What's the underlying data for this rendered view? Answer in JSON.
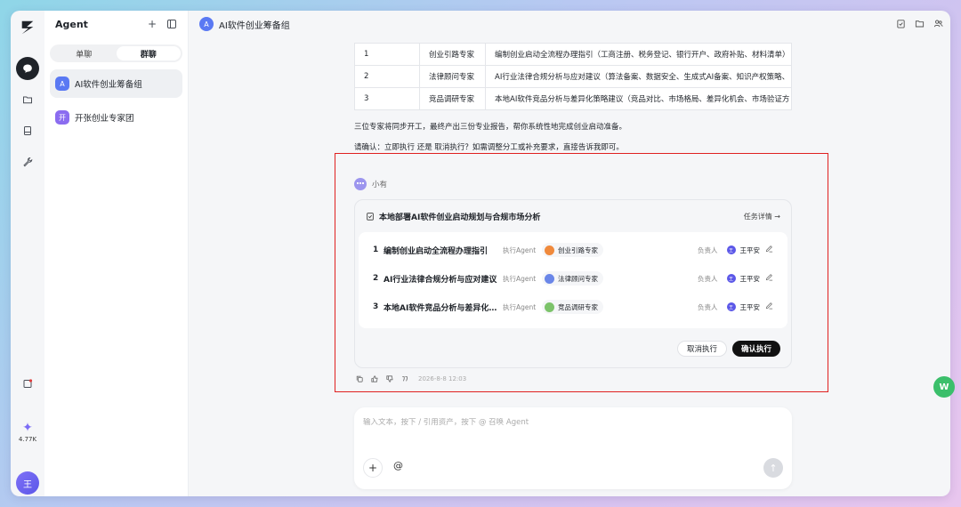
{
  "sidebar": {
    "title": "Agent",
    "tabs": [
      "单聊",
      "群聊"
    ],
    "active_tab": "群聊",
    "conversations": [
      {
        "avatar": "A",
        "label": "AI软件创业筹备组",
        "color": "#5a79f3"
      },
      {
        "avatar": "开",
        "label": "开张创业专家团",
        "color": "#8b6cf0"
      }
    ]
  },
  "rail": {
    "credits": "4.77K",
    "user_avatar": "王"
  },
  "header": {
    "avatar": "A",
    "title": "AI软件创业筹备组"
  },
  "table": {
    "rows": [
      {
        "no": "1",
        "role": "创业引路专家",
        "desc": "编制创业启动全流程办理指引（工商注册、税务登记、银行开户、政府补贴、材料清单）"
      },
      {
        "no": "2",
        "role": "法律顾问专家",
        "desc": "AI行业法律合规分析与应对建议（算法备案、数据安全、生成式AI备案、知识产权策略、"
      },
      {
        "no": "3",
        "role": "竞品调研专家",
        "desc": "本地AI软件竞品分析与差异化策略建议（竞品对比、市场格局、差异化机会、市场验证方"
      }
    ]
  },
  "messages": {
    "para1": "三位专家将同步开工，最终产出三份专业报告，帮你系统性地完成创业启动准备。",
    "para2": "请确认：立即执行 还是 取消执行？如需调整分工或补充要求，直接告诉我即可。"
  },
  "agent_message": {
    "sender": "小有",
    "card_title": "本地部署AI软件创业启动规划与合规市场分析",
    "detail_link": "任务详情 →",
    "exec_label": "执行Agent",
    "owner_label": "负责人",
    "tasks": [
      {
        "no": "1",
        "name": "编制创业启动全流程办理指引",
        "agent": "创业引路专家",
        "agent_color": "#f08a3c",
        "owner_avatar": "王",
        "owner": "王平安"
      },
      {
        "no": "2",
        "name": "AI行业法律合规分析与应对建议",
        "agent": "法律顾问专家",
        "agent_color": "#6a86e8",
        "owner_avatar": "王",
        "owner": "王平安"
      },
      {
        "no": "3",
        "name": "本地AI软件竞品分析与差异化…",
        "agent": "竞品调研专家",
        "agent_color": "#7cc36a",
        "owner_avatar": "王",
        "owner": "王平安"
      }
    ],
    "cancel_label": "取消执行",
    "confirm_label": "确认执行",
    "timestamp": "2026-8-8 12:03"
  },
  "composer": {
    "placeholder": "输入文本，按下 / 引用资产，按下 @ 召唤 Agent",
    "at_label": "@"
  },
  "floating_badge": "W",
  "colors": {
    "accent": "#5b57e8",
    "highlight": "#e02020",
    "primary_button": "#111111"
  }
}
